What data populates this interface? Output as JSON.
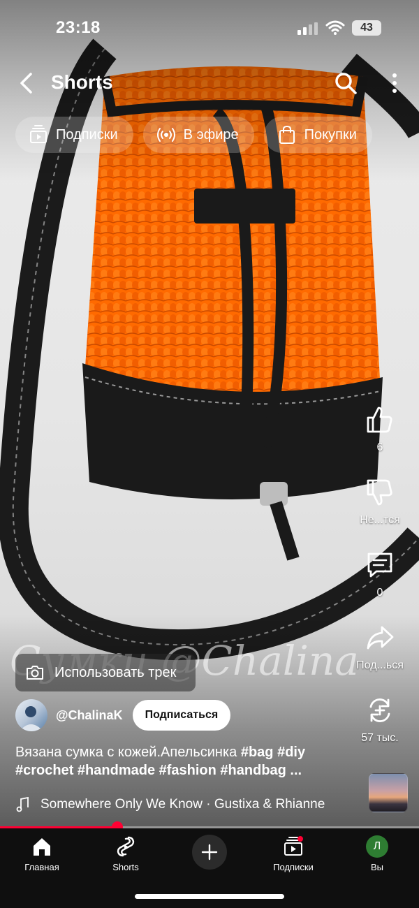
{
  "status_bar": {
    "time": "23:18",
    "battery": "43"
  },
  "top_nav": {
    "title": "Shorts"
  },
  "chips": [
    {
      "label": "Подписки",
      "icon": "subscriptions-icon"
    },
    {
      "label": "В эфире",
      "icon": "live-icon"
    },
    {
      "label": "Покупки",
      "icon": "shopping-bag-icon"
    }
  ],
  "actions": {
    "like_count": "6",
    "dislike_label": "Не...тся",
    "comment_count": "0",
    "share_label": "Под...ься",
    "remix_label": "57 тыс."
  },
  "overlay": {
    "watermark": "Сумки @Chalina",
    "use_track": "Использовать трек"
  },
  "channel": {
    "handle": "@ChalinaK",
    "subscribe_label": "Подписаться"
  },
  "description": {
    "text": "Вязана сумка с кожей.Апельсинка ",
    "tags_line1": "#bag #diy",
    "tags_line2": "#crochet #handmade #fashion #handbag ..."
  },
  "music": {
    "track": "Somewhere Only We Know · Gustixa & Rhianne"
  },
  "progress": {
    "fraction": 0.28
  },
  "bottom_nav": {
    "home": "Главная",
    "shorts": "Shorts",
    "subscriptions": "Подписки",
    "you": "Вы",
    "avatar_letter": "Л"
  },
  "colors": {
    "accent": "#ff0033",
    "bag_orange": "#ff6a00",
    "leather": "#1a1a1a"
  }
}
